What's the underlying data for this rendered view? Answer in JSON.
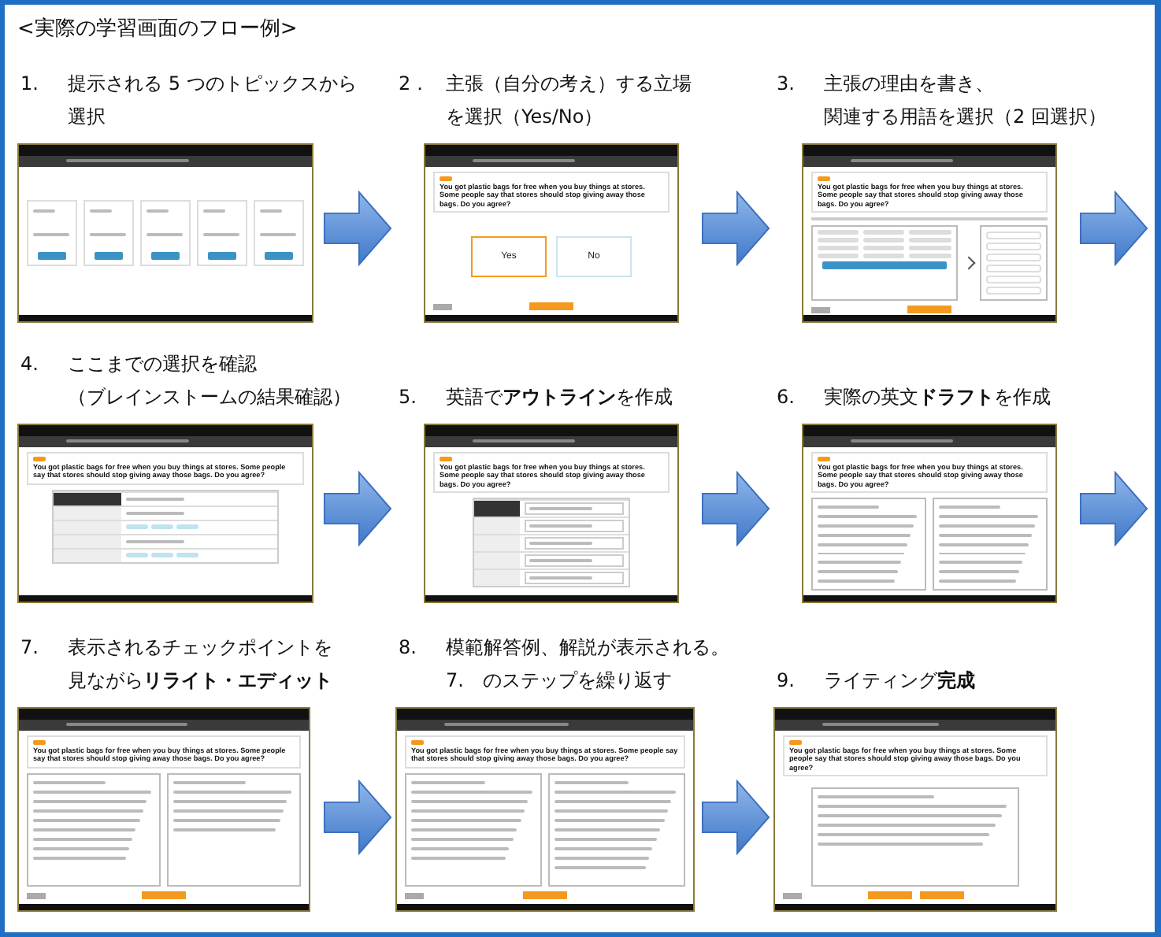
{
  "title": "<実際の学習画面のフロー例>",
  "steps": [
    {
      "number": "1.",
      "lines": [
        "提示される 5 つのトピックスから",
        "選択"
      ],
      "next_arrow": true,
      "screen": {
        "kind": "topics"
      }
    },
    {
      "number": "2．",
      "lines": [
        "主張（自分の考え）する立場",
        "を選択（Yes/No）"
      ],
      "next_arrow": true,
      "screen": {
        "kind": "choice",
        "question": "You got plastic bags for free when you buy things at stores. Some people say that stores should stop giving away those bags. Do you agree?",
        "options": [
          {
            "label": "Yes",
            "selected": true
          },
          {
            "label": "No",
            "selected": false
          }
        ]
      }
    },
    {
      "number": "3.",
      "lines": [
        "主張の理由を書き、",
        "関連する用語を選択（2 回選択）"
      ],
      "next_arrow": true,
      "screen": {
        "kind": "terms",
        "question": "You got plastic bags for free when you buy things at stores. Some people say that stores should stop giving away those bags. Do you agree?"
      }
    },
    {
      "number": "4.",
      "lines": [
        "ここまでの選択を確認",
        "（ブレインストームの結果確認）"
      ],
      "next_arrow": true,
      "screen": {
        "kind": "review",
        "question": "You got plastic bags for free when you buy things at stores. Some people say that stores should stop giving away those bags. Do you agree?"
      }
    },
    {
      "number": "5.",
      "lines": [
        "英語で**アウトライン**を作成"
      ],
      "next_arrow": true,
      "screen": {
        "kind": "outline",
        "question": "You got plastic bags for free when you buy things at stores. Some people say that stores should stop giving away those bags. Do you agree?"
      }
    },
    {
      "number": "6.",
      "lines": [
        "実際の英文**ドラフト**を作成"
      ],
      "next_arrow": true,
      "screen": {
        "kind": "draft",
        "question": "You got plastic bags for free when you buy things at stores. Some people say that stores should stop giving away those bags. Do you agree?"
      }
    },
    {
      "number": "7.",
      "lines": [
        "表示されるチェックポイントを",
        "見ながら**リライト・エディット**"
      ],
      "next_arrow": true,
      "screen": {
        "kind": "rewrite",
        "question": "You got plastic bags for free when you buy things at stores. Some people say that stores should stop giving away those bags. Do you agree?"
      }
    },
    {
      "number": "8.",
      "lines": [
        "模範解答例、解説が表示される。",
        "7.　のステップを繰り返す"
      ],
      "next_arrow": true,
      "screen": {
        "kind": "model",
        "question": "You got plastic bags for free when you buy things at stores. Some people say that stores should stop giving away those bags. Do you agree?"
      }
    },
    {
      "number": "9.",
      "lines": [
        "ライティング**完成**"
      ],
      "next_arrow": false,
      "screen": {
        "kind": "complete",
        "question": "You got plastic bags for free when you buy things at stores. Some people say that stores should stop giving away those bags. Do you agree?"
      }
    }
  ]
}
